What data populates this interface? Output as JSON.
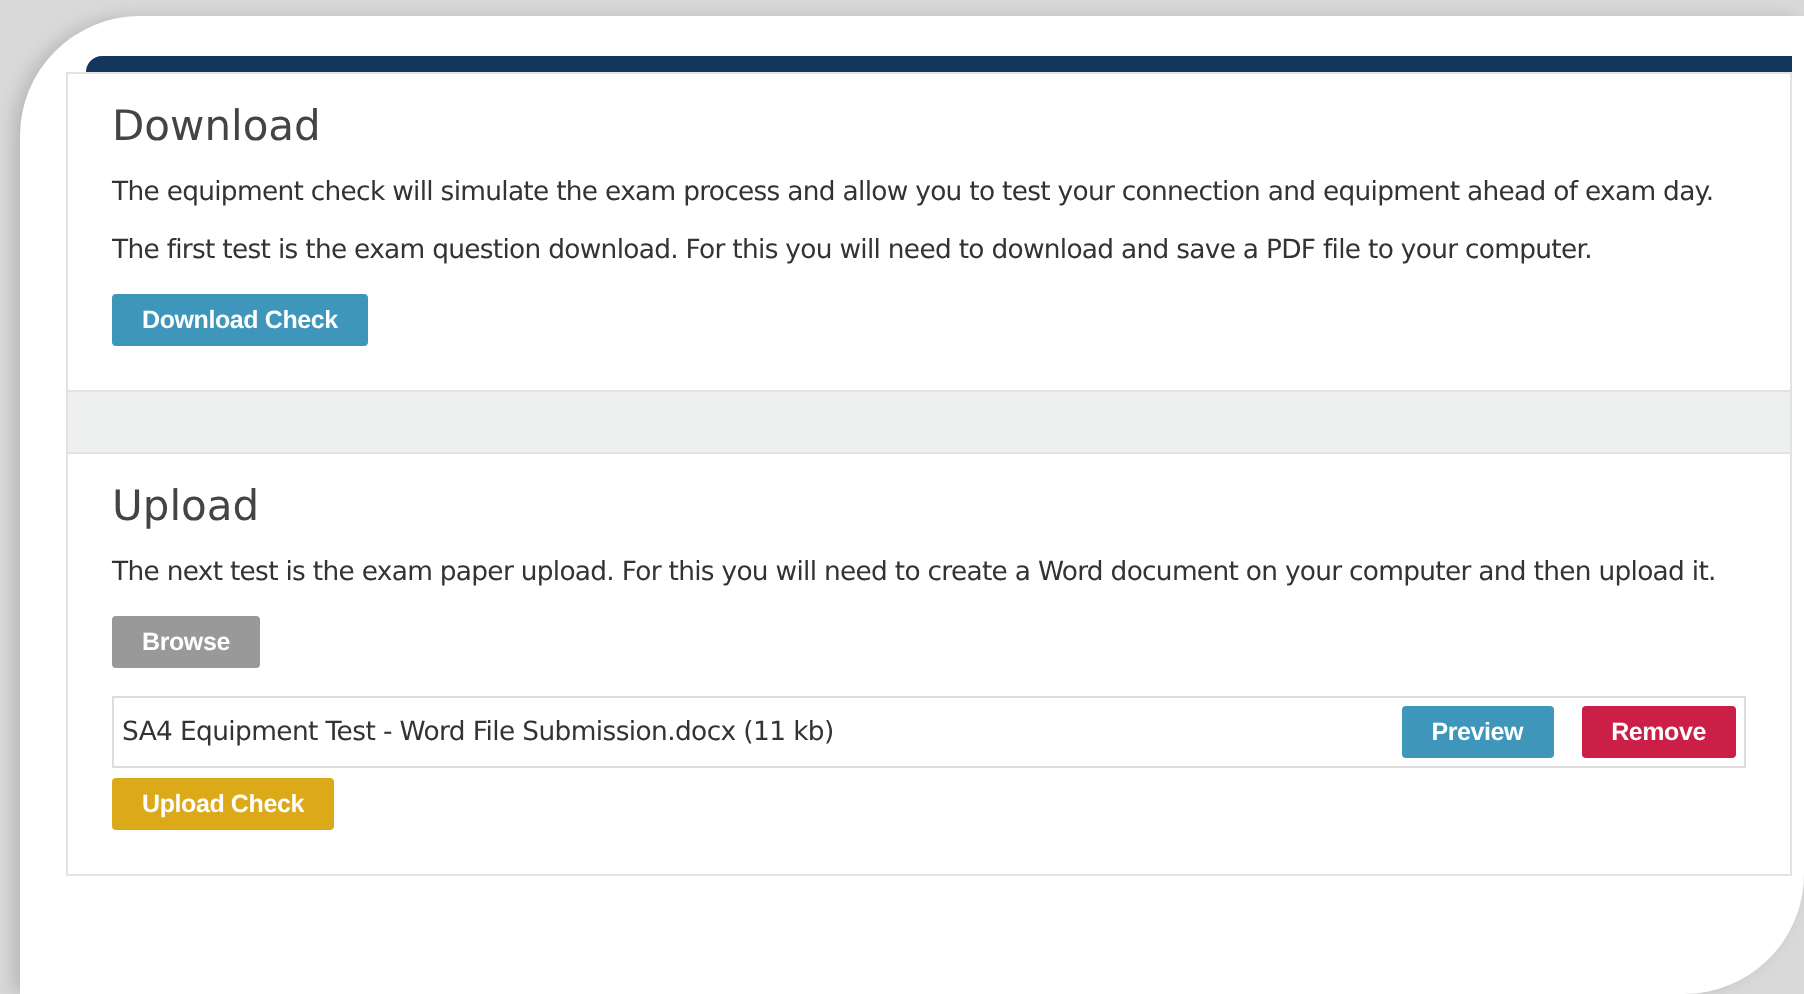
{
  "sections": [
    {
      "title": "Download",
      "paragraphs": [
        "The equipment check will simulate the exam process and allow you to test your connection and equipment ahead of exam day.",
        "The first test is the exam question download. For this you will need to download and save a PDF file to your computer."
      ],
      "buttons": [
        {
          "label": "Download Check",
          "kind": "info"
        }
      ]
    },
    {
      "title": "Upload",
      "paragraphs": [
        "The next test is the exam paper upload. For this you will need to create a Word document on your computer and then upload it."
      ],
      "buttons": [
        {
          "label": "Browse",
          "kind": "default"
        }
      ],
      "file": {
        "name": "SA4 Equipment Test - Word File Submission.docx (11 kb)",
        "buttons": [
          {
            "label": "Preview",
            "kind": "info"
          },
          {
            "label": "Remove",
            "kind": "danger"
          }
        ]
      },
      "footer_buttons": [
        {
          "label": "Upload Check",
          "kind": "warning"
        }
      ]
    }
  ]
}
